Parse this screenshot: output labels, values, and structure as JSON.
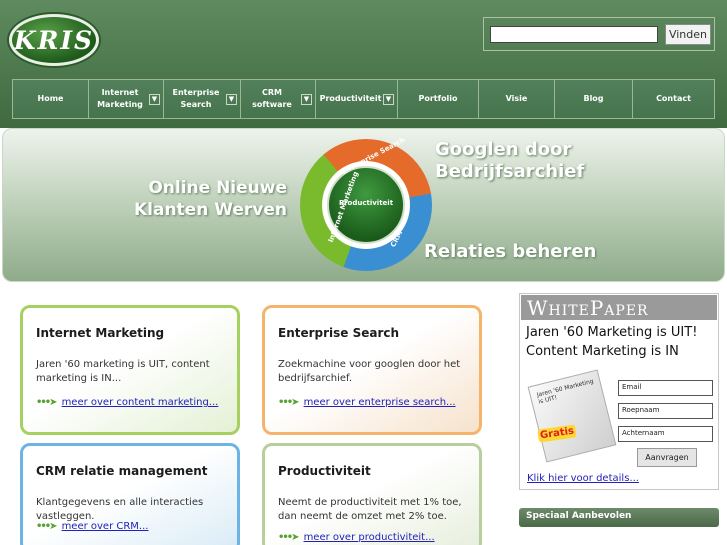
{
  "logo": {
    "text": "KRIS"
  },
  "search": {
    "button": "Vinden",
    "value": ""
  },
  "nav": [
    {
      "label": "Home",
      "dropdown": false
    },
    {
      "label": "Internet\nMarketing",
      "dropdown": true
    },
    {
      "label": "Enterprise\nSearch",
      "dropdown": true
    },
    {
      "label": "CRM\nsoftware",
      "dropdown": true
    },
    {
      "label": "Productiviteit",
      "dropdown": true
    },
    {
      "label": "Portfolio",
      "dropdown": false
    },
    {
      "label": "Visie",
      "dropdown": false
    },
    {
      "label": "Blog",
      "dropdown": false
    },
    {
      "label": "Contact",
      "dropdown": false
    }
  ],
  "banner": {
    "left_text": "Online Nieuwe\nKlanten Werven",
    "top_right_text": "Googlen door\nBedrijfsarchief",
    "bottom_right_text": "Relaties beheren",
    "center_label": "Productiviteit",
    "ring_labels": [
      "Enterprise Search",
      "Internet Marketing",
      "CRM"
    ]
  },
  "boxes": [
    {
      "title": "Internet Marketing",
      "desc": "Jaren '60 marketing is UIT, content marketing is IN...",
      "link": "meer over content marketing..."
    },
    {
      "title": "Enterprise Search",
      "desc": "Zoekmachine voor googlen door het bedrijfsarchief.",
      "link": "meer over enterprise search..."
    },
    {
      "title": "CRM relatie management",
      "desc": "Klantgegevens en alle interacties vastleggen.",
      "link": "meer over CRM..."
    },
    {
      "title": "Productiviteit",
      "desc": "Neemt de productiviteit met 1% toe,\ndan neemt de omzet met 2% toe.",
      "link": "meer over productiviteit..."
    }
  ],
  "whitepaper": {
    "header": "WhitePaper",
    "subtitle": "Jaren '60 Marketing is UIT!\nContent Marketing is IN",
    "book_text": "Jaren '60 Marketing is UIT!",
    "badge": "Gratis",
    "fields": [
      "Email",
      "Roepnaam",
      "Achternaam"
    ],
    "button": "Aanvragen",
    "link": "Klik hier voor details..."
  },
  "recommended": {
    "title": "Speciaal Aanbevolen"
  }
}
